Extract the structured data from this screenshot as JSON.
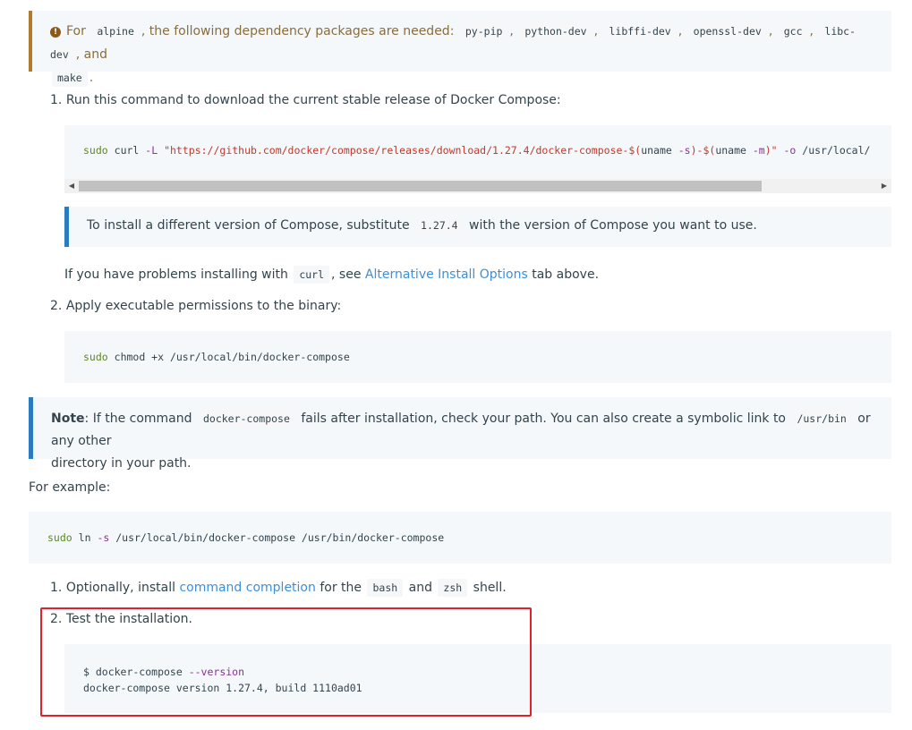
{
  "warning": {
    "icon": "exclamation-circle-icon",
    "t1": "For",
    "code1": "alpine",
    "t2": ", the following dependency packages are needed:",
    "pkgs": [
      "py-pip",
      "python-dev",
      "libffi-dev",
      "openssl-dev",
      "gcc",
      "libc-dev"
    ],
    "sep": ",",
    "t3": ", and",
    "last_pkg": "make",
    "end": "."
  },
  "step1": {
    "number": "1.",
    "text": "Run this command to download the current stable release of Docker Compose:",
    "cmd_kw": "sudo",
    "cmd_curl": "curl",
    "cmd_flag": "-L",
    "cmd_url": "\"https://github.com/docker/compose/releases/download/1.27.4/docker-compose-$(",
    "cmd_uname1": "uname",
    "cmd_s": " -s",
    "cmd_mid": ")-$(",
    "cmd_uname2": "uname",
    "cmd_m": " -m",
    "cmd_close": ")\"",
    "cmd_o": " -o",
    "cmd_path": " /usr/local/"
  },
  "tip": {
    "t1": "To install a different version of Compose, substitute",
    "code": "1.27.4",
    "t2": "with the version of Compose you want to use."
  },
  "problems": {
    "t1": "If you have problems installing with",
    "code": "curl",
    "t2": ", see",
    "link": "Alternative Install Options",
    "t3": "tab above."
  },
  "step2": {
    "number": "2.",
    "text": "Apply executable permissions to the binary:",
    "cmd_kw": "sudo",
    "cmd_rest": "chmod +x /usr/local/bin/docker-compose"
  },
  "note": {
    "label": "Note",
    "t1": ": If the command",
    "code1": "docker-compose",
    "t2": "fails after installation, check your path. You can also create a symbolic link to",
    "code2": "/usr/bin",
    "t3": "or any other",
    "t4": "directory in your path."
  },
  "example": {
    "label": "For example:",
    "cmd_kw": "sudo",
    "cmd_ln": "ln",
    "cmd_flag": "-s",
    "cmd_rest": " /usr/local/bin/docker-compose /usr/bin/docker-compose"
  },
  "step3": {
    "number": "1.",
    "t1": "Optionally, install",
    "link": "command completion",
    "t2": "for the",
    "code1": "bash",
    "t3": "and",
    "code2": "zsh",
    "t4": "shell."
  },
  "step4": {
    "number": "2.",
    "text": "Test the installation.",
    "line1_prompt": "$ docker-compose",
    "line1_flag": " --version",
    "line2": "docker-compose version 1.27.4, build 1110ad01"
  },
  "scrollbar": {
    "left_arrow": "◀",
    "right_arrow": "▶"
  }
}
